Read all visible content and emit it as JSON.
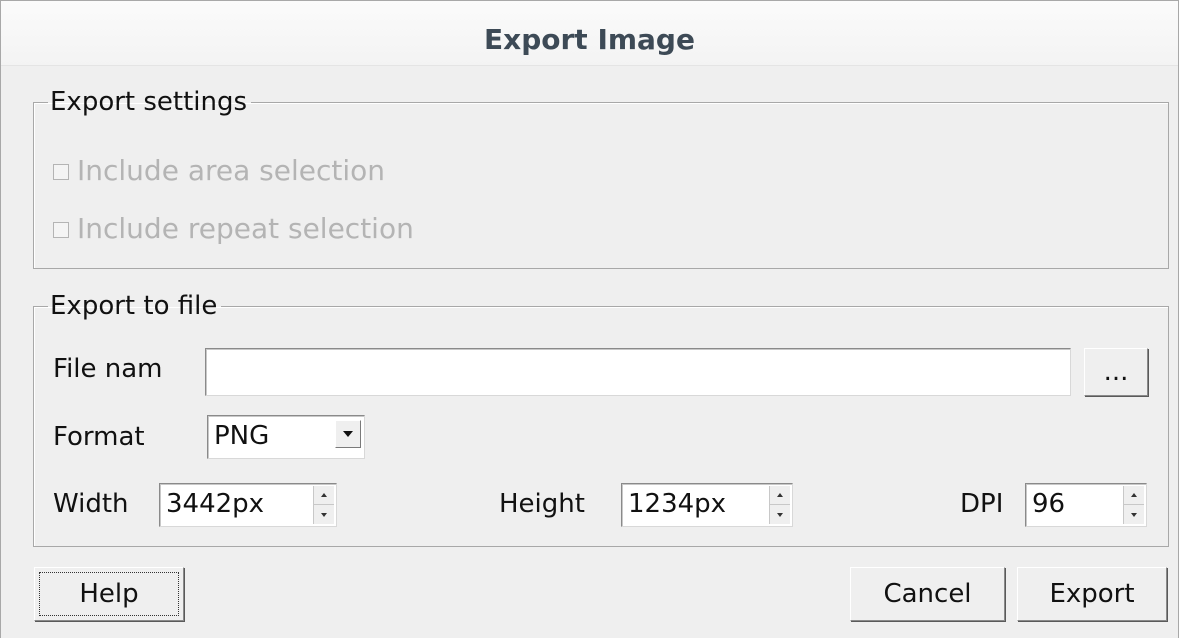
{
  "dialog": {
    "title": "Export Image"
  },
  "settings": {
    "legend": "Export settings",
    "include_area": {
      "label": "Include area selection",
      "checked": false,
      "enabled": false
    },
    "include_repeat": {
      "label": "Include repeat selection",
      "checked": false,
      "enabled": false
    }
  },
  "export": {
    "legend": "Export to file",
    "file_name_label": "File nam",
    "file_name_value": "",
    "browse_label": "...",
    "format_label": "Format",
    "format_value": "PNG",
    "width_label": "Width",
    "width_value": "3442px",
    "height_label": "Height",
    "height_value": "1234px",
    "dpi_label": "DPI",
    "dpi_value": "96"
  },
  "buttons": {
    "help": "Help",
    "cancel": "Cancel",
    "export": "Export"
  },
  "icons": {
    "checkbox": "checkbox-icon",
    "spin_up": "spin-up-icon",
    "spin_down": "spin-down-icon",
    "combo_arrow": "chevron-down-icon"
  }
}
